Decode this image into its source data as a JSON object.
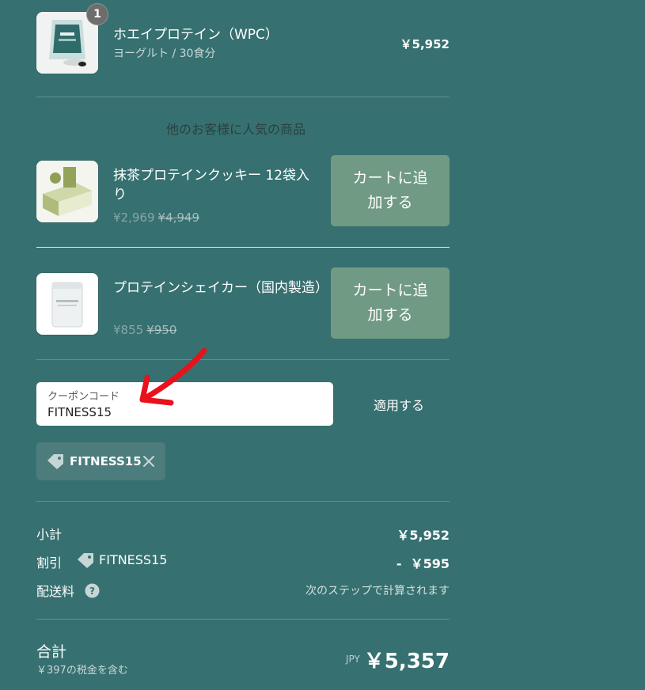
{
  "cart_item": {
    "quantity": "1",
    "title": "ホエイプロテイン（WPC）",
    "variant": "ヨーグルト / 30食分",
    "price": "￥5,952"
  },
  "recommendations": {
    "heading": "他のお客様に人気の商品",
    "items": [
      {
        "title": "抹茶プロテインクッキー 12袋入り",
        "sale_price": "¥2,969",
        "original_price": "¥4,949",
        "add_label": "カートに追加する"
      },
      {
        "title": "プロテインシェイカー（国内製造）",
        "sale_price": "¥855",
        "original_price": "¥950",
        "add_label": "カートに追加する"
      }
    ]
  },
  "coupon": {
    "field_label": "クーポンコード",
    "value": "FITNESS15",
    "apply_label": "適用する",
    "applied_code": "FITNESS15"
  },
  "summary": {
    "subtotal_label": "小計",
    "subtotal_value": "￥5,952",
    "discount_label": "割引",
    "discount_code": "FITNESS15",
    "discount_value": "-  ￥595",
    "shipping_label": "配送料",
    "shipping_value": "次のステップで計算されます",
    "total_label": "合計",
    "tax_note": "￥397の税金を含む",
    "currency": "JPY",
    "total_value": "￥5,357"
  },
  "icons": {
    "remove": "close-icon",
    "tag": "tag-icon",
    "help": "help-icon",
    "annotation": "arrow-icon"
  },
  "colors": {
    "background": "#377070",
    "add_button": "#709a83",
    "annotation_arrow": "#e8111c"
  }
}
